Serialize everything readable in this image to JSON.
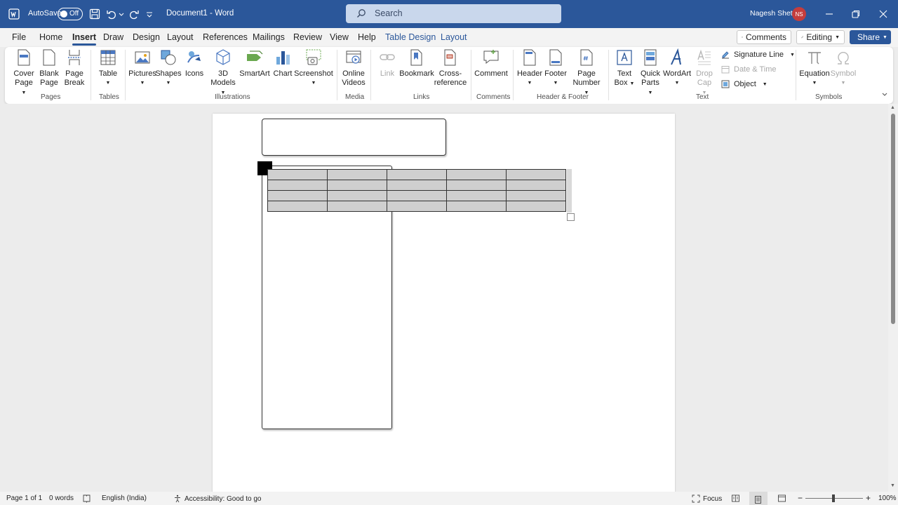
{
  "titlebar": {
    "autosave_label": "AutoSave",
    "autosave_state": "Off",
    "document_name": "Document1",
    "separator": "-",
    "app_name": "Word",
    "search_placeholder": "Search",
    "user_name": "Nagesh Shetti",
    "user_initials": "NS"
  },
  "menu": {
    "tabs": [
      "File",
      "Home",
      "Insert",
      "Draw",
      "Design",
      "Layout",
      "References",
      "Mailings",
      "Review",
      "View",
      "Help",
      "Table Design",
      "Layout"
    ],
    "active_tab": "Insert",
    "comments_label": "Comments",
    "editing_label": "Editing",
    "share_label": "Share"
  },
  "ribbon": {
    "pages": {
      "group_label": "Pages",
      "cover_l1": "Cover",
      "cover_l2": "Page",
      "blank_l1": "Blank",
      "blank_l2": "Page",
      "break_l1": "Page",
      "break_l2": "Break"
    },
    "tables": {
      "group_label": "Tables",
      "table": "Table"
    },
    "illustrations": {
      "group_label": "Illustrations",
      "pictures": "Pictures",
      "shapes": "Shapes",
      "icons": "Icons",
      "models_l1": "3D",
      "models_l2": "Models",
      "smartart": "SmartArt",
      "chart": "Chart",
      "screenshot": "Screenshot"
    },
    "media": {
      "group_label": "Media",
      "videos_l1": "Online",
      "videos_l2": "Videos"
    },
    "links": {
      "group_label": "Links",
      "link": "Link",
      "bookmark": "Bookmark",
      "cross_l1": "Cross-",
      "cross_l2": "reference"
    },
    "comments": {
      "group_label": "Comments",
      "comment": "Comment"
    },
    "header_footer": {
      "group_label": "Header & Footer",
      "header": "Header",
      "footer": "Footer",
      "pagenum_l1": "Page",
      "pagenum_l2": "Number"
    },
    "text": {
      "group_label": "Text",
      "textbox_l1": "Text",
      "textbox_l2": "Box",
      "quickparts_l1": "Quick",
      "quickparts_l2": "Parts",
      "wordart": "WordArt",
      "dropcap_l1": "Drop",
      "dropcap_l2": "Cap",
      "signature_line": "Signature Line",
      "date_time": "Date & Time",
      "object": "Object"
    },
    "symbols": {
      "group_label": "Symbols",
      "equation": "Equation",
      "symbol": "Symbol"
    }
  },
  "document": {
    "table_rows": 4,
    "table_cols": 5
  },
  "statusbar": {
    "page": "Page 1 of 1",
    "words": "0 words",
    "language": "English (India)",
    "accessibility": "Accessibility: Good to go",
    "focus": "Focus",
    "zoom": "100%"
  },
  "colors": {
    "accent": "#2b579a",
    "avatar": "#c43d3d"
  }
}
